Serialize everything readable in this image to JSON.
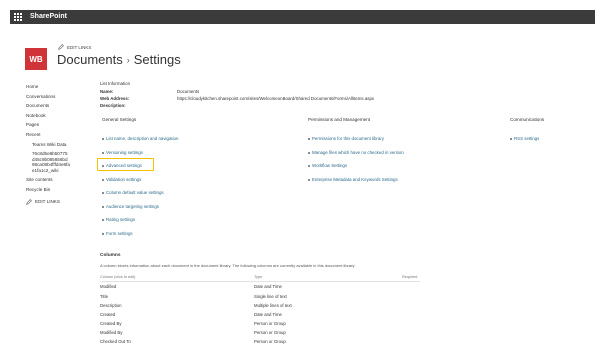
{
  "app": {
    "name": "SharePoint"
  },
  "site": {
    "logo_text": "WB",
    "edit_links": "EDIT LINKS"
  },
  "page": {
    "title_left": "Documents",
    "separator": "›",
    "title_right": "Settings"
  },
  "left_nav": {
    "items": [
      "Home",
      "Conversations",
      "Documents",
      "Notebook",
      "Pages",
      "Recent"
    ],
    "recent_children": [
      "Teams Wiki Data",
      "76c8d5e8b50775d45c9b085656bd98ca08b4fffd4e8fae1fa1c2_wiki"
    ],
    "tail_items": [
      "Site contents",
      "Recycle Bin"
    ],
    "edit_links": "EDIT LINKS"
  },
  "list_info": {
    "heading": "List Information",
    "name_label": "Name:",
    "name_value": "Documents",
    "address_label": "Web Address:",
    "address_value": "https://cloudykitchen.sharepoint.com/sites/WelcomeonBoard/Shared Documents/Forms/AllItems.aspx",
    "description_label": "Description:"
  },
  "sections": {
    "general": {
      "heading": "General Settings",
      "links": [
        "List name, description and navigation",
        "Versioning settings",
        "Advanced settings",
        "Validation settings",
        "Column default value settings",
        "Audience targeting settings",
        "Rating settings",
        "Form settings"
      ]
    },
    "permissions": {
      "heading": "Permissions and Management",
      "links": [
        "Permissions for this document library",
        "Manage files which have no checked in version",
        "Workflow Settings",
        "Enterprise Metadata and Keywords Settings"
      ]
    },
    "communications": {
      "heading": "Communications",
      "links": [
        "RSS settings"
      ]
    }
  },
  "highlight_color": "#f2c200",
  "link_color": "#2b6a8c",
  "columns": {
    "heading": "Columns",
    "description": "A column stores information about each document in the document library. The following columns are currently available in this document library:",
    "headers": [
      "Column (click to edit)",
      "Type",
      "Required"
    ],
    "rows": [
      [
        "Modified",
        "Date and Time"
      ],
      [
        "Title",
        "Single line of text"
      ],
      [
        "Description",
        "Multiple lines of text"
      ],
      [
        "Created",
        "Date and Time"
      ],
      [
        "Created By",
        "Person or Group"
      ],
      [
        "Modified By",
        "Person or Group"
      ],
      [
        "Checked Out To",
        "Person or Group"
      ]
    ]
  }
}
